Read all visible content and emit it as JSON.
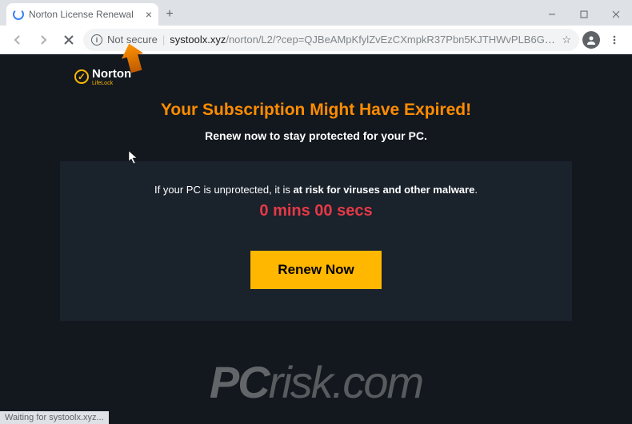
{
  "browser": {
    "tab_title": "Norton License Renewal",
    "not_secure_label": "Not secure",
    "url_host": "systoolx.xyz",
    "url_path": "/norton/L2/?cep=QJBeAMpKfylZvEzCXmpkR37Pbn5KJTHWvPLB6G_-rHI5sH_s9i5rkxVS6var4KWAw7Ml...",
    "status_text": "Waiting for systoolx.xyz..."
  },
  "brand": {
    "name": "Norton",
    "sub": "LifeLock"
  },
  "hero": {
    "title": "Your Subscription Might Have Expired!",
    "subtitle": "Renew now to stay protected for your PC."
  },
  "body": {
    "risk_prefix": "If your PC is unprotected, it is ",
    "risk_bold": "at risk for viruses and other malware",
    "risk_suffix": ".",
    "countdown": "0 mins 00 secs",
    "cta_label": "Renew Now"
  },
  "watermark": {
    "pc": "PC",
    "risk": "risk",
    "dotcom": ".com"
  }
}
